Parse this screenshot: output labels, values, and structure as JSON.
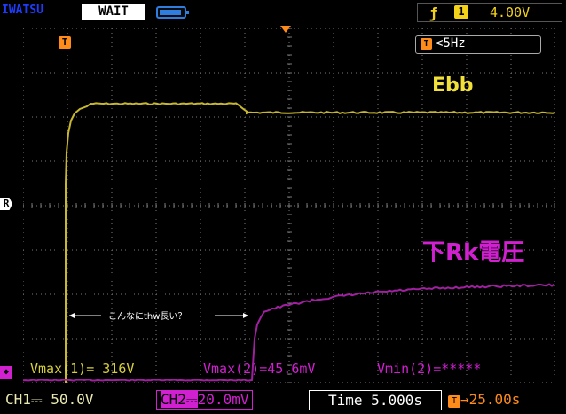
{
  "header": {
    "brand": "IWATSU",
    "mode": "WAIT",
    "battery_icon": "battery-icon",
    "trigger_edge_icon": "rising-edge-icon",
    "trigger_channel": "1",
    "trigger_level": "4.00V"
  },
  "markers": {
    "trigger_time": "T",
    "reference": "R",
    "ch2_ground": "◆"
  },
  "readout": {
    "freq_icon": "T",
    "freq": "<5Hz"
  },
  "labels": {
    "ch1_name": "Ebb",
    "ch2_name": "下Rk電圧",
    "annotation_left_arrow": "←——",
    "annotation": "こんなにthw長い？",
    "annotation_right_arrow": "——→"
  },
  "measurements": {
    "m1": "Vmax(1)= 316V",
    "m2": "Vmax(2)=45.6mV",
    "m3": "Vmin(2)=*****"
  },
  "status": {
    "ch1": "CH1⎓ 50.0V",
    "ch2_label": "CH2⎓",
    "ch2_value": "20.0mV",
    "time": "Time 5.000s",
    "trig_icon": "T",
    "trig_offset": "→25.00s"
  },
  "colors": {
    "ch1": "#c8b830",
    "ch2": "#a020a0",
    "trigger": "#ff8c1a",
    "grid": "#7a7a7a"
  }
}
